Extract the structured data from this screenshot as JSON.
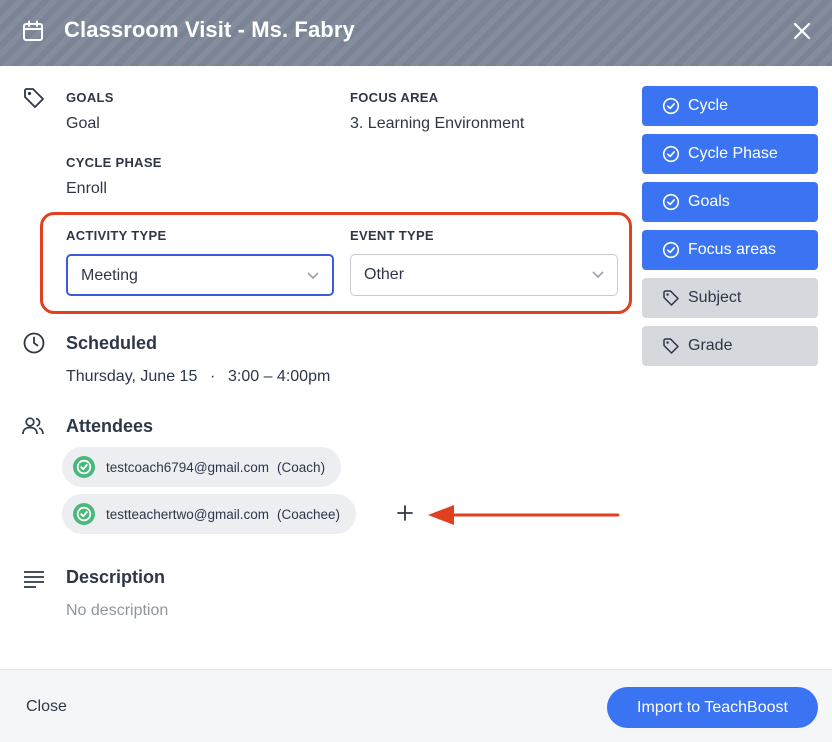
{
  "header": {
    "title": "Classroom Visit - Ms. Fabry"
  },
  "details": {
    "goals_label": "GOALS",
    "goals_value": "Goal",
    "focus_label": "FOCUS AREA",
    "focus_value": "3. Learning Environment",
    "cycle_phase_label": "CYCLE PHASE",
    "cycle_phase_value": "Enroll"
  },
  "selects": {
    "activity_label": "ACTIVITY TYPE",
    "activity_value": "Meeting",
    "event_label": "EVENT TYPE",
    "event_value": "Other"
  },
  "scheduled": {
    "title": "Scheduled",
    "date": "Thursday, June 15",
    "separator": "·",
    "time": "3:00 – 4:00pm"
  },
  "attendees": {
    "title": "Attendees",
    "list": [
      {
        "email": "testcoach6794@gmail.com",
        "role": "(Coach)"
      },
      {
        "email": "testteachertwo@gmail.com",
        "role": "(Coachee)"
      }
    ]
  },
  "description": {
    "title": "Description",
    "value": "No description"
  },
  "sidebar": {
    "buttons": [
      {
        "label": "Cycle",
        "state": "selected"
      },
      {
        "label": "Cycle Phase",
        "state": "selected"
      },
      {
        "label": "Goals",
        "state": "selected"
      },
      {
        "label": "Focus areas",
        "state": "selected"
      },
      {
        "label": "Subject",
        "state": "unselected"
      },
      {
        "label": "Grade",
        "state": "unselected"
      }
    ]
  },
  "footer": {
    "close_label": "Close",
    "import_label": "Import to TeachBoost"
  },
  "colors": {
    "accent_blue": "#3b74f2",
    "highlight_red": "#e0401f",
    "check_green": "#48b97a",
    "header_gray": "#7a8494"
  }
}
